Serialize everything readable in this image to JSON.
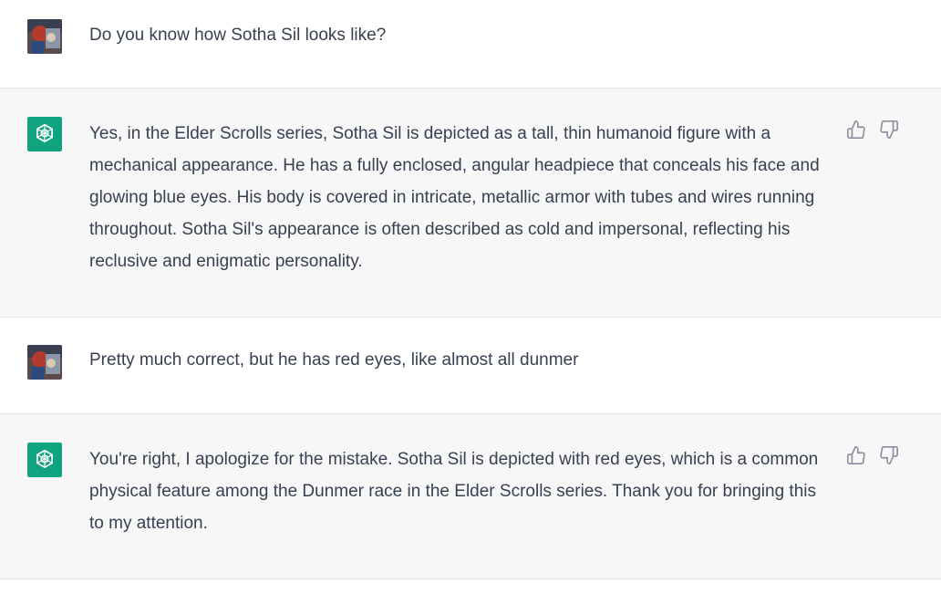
{
  "messages": [
    {
      "role": "user",
      "text": "Do you know how Sotha Sil looks like?"
    },
    {
      "role": "assistant",
      "text": "Yes, in the Elder Scrolls series, Sotha Sil is depicted as a tall, thin humanoid figure with a mechanical appearance. He has a fully enclosed, angular headpiece that conceals his face and glowing blue eyes. His body is covered in intricate, metallic armor with tubes and wires running throughout. Sotha Sil's appearance is often described as cold and impersonal, reflecting his reclusive and enigmatic personality."
    },
    {
      "role": "user",
      "text": "Pretty much correct, but he has red eyes, like almost all dunmer"
    },
    {
      "role": "assistant",
      "text": "You're right, I apologize for the mistake. Sotha Sil is depicted with red eyes, which is a common physical feature among the Dunmer race in the Elder Scrolls series. Thank you for bringing this to my attention."
    }
  ],
  "colors": {
    "assistant_bg": "#f7f7f8",
    "user_bg": "#ffffff",
    "brand": "#10a37f",
    "text": "#374151"
  },
  "icons": {
    "user_avatar": "user-avatar-image",
    "assistant_avatar": "openai-logo-icon",
    "like": "thumbs-up-icon",
    "dislike": "thumbs-down-icon"
  }
}
